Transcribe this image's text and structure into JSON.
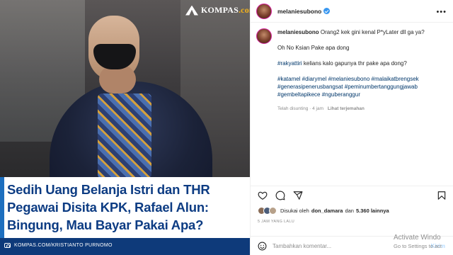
{
  "image": {
    "brand": {
      "name": "KOMPAS",
      "suffix": ".com"
    },
    "headline": [
      "Sedih Uang Belanja Istri dan THR",
      "Pegawai Disita KPK, Rafael Alun:",
      "Bingung, Mau Bayar Pakai Apa?"
    ],
    "credit": "KOMPAS.COM/KRISTIANTO PURNOMO"
  },
  "header": {
    "username": "melaniesubono",
    "verified": true
  },
  "caption": {
    "username": "melaniesubono",
    "lines": [
      "Orang2 kek gini kenal P*yLater dll ga ya?",
      "Oh No Ksian Pake apa dong",
      "#rakyattiri kelians kalo gapunya thr pake apa dong?"
    ],
    "hashtags": [
      "#katamel #diarymel #melaniesubono #malaikatbrengsek",
      "#generasipenerusbangsat #peminumbertanggungjawab",
      "#gembeltapikece #nguberanggur"
    ],
    "edited_time": "Telah disunting · 4 jam",
    "translate": "Lihat terjemahan"
  },
  "likes": {
    "prefix": "Disukai oleh",
    "user": "don_damara",
    "connector": "dan",
    "count": "5.360 lainnya"
  },
  "time_ago": "5 JAM YANG LALU",
  "comment_box": {
    "placeholder": "Tambahkan komentar...",
    "post_label": "Kirim"
  },
  "watermark": {
    "title": "Activate Windo",
    "subtitle": "Go to Settings to act"
  },
  "colors": {
    "headline": "#0d3c83",
    "accent": "#1d6fbf",
    "hashtag": "#00376b",
    "verified": "#3897f0"
  }
}
